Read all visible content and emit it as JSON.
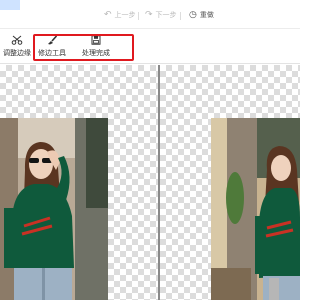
{
  "history": {
    "undo_label": "上一步",
    "redo_label": "下一步",
    "reset_label": "重做"
  },
  "toolbar": {
    "tools": [
      {
        "label": "调整边缘",
        "icon": "scissors-icon"
      },
      {
        "label": "修边工具",
        "icon": "brush-icon"
      },
      {
        "label": "处理完成",
        "icon": "save-icon"
      }
    ]
  },
  "colors": {
    "highlight": "#e0191f",
    "sweater": "#0f5a3c",
    "checker": "#dcdcdc"
  }
}
